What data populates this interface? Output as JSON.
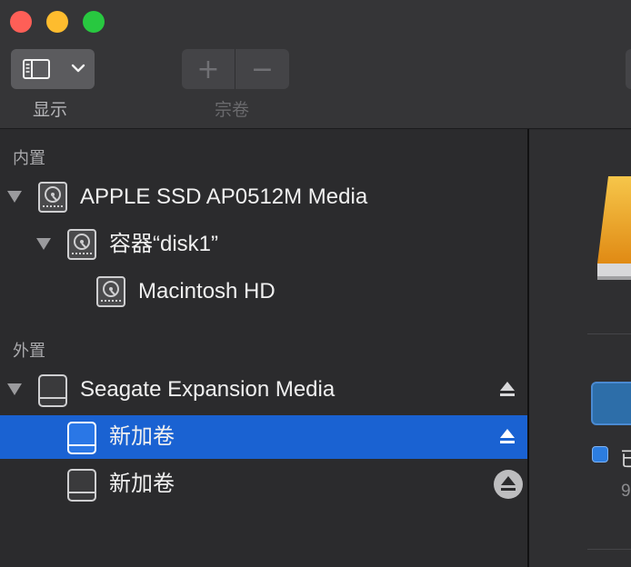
{
  "toolbar": {
    "display_label": "显示",
    "volume_label": "宗卷",
    "add_symbol": "+",
    "remove_symbol": "−"
  },
  "sidebar": {
    "internal_header": "内置",
    "external_header": "外置",
    "items": [
      {
        "label": "APPLE SSD AP0512M Media",
        "icon": "internal-disk-icon",
        "expanded": true
      },
      {
        "label": "容器“disk1”",
        "icon": "internal-disk-icon",
        "expanded": true
      },
      {
        "label": "Macintosh HD",
        "icon": "internal-disk-icon"
      },
      {
        "label": "Seagate Expansion Media",
        "icon": "external-disk-icon",
        "expanded": true,
        "eject": true
      },
      {
        "label": "新加卷",
        "icon": "external-disk-icon",
        "selected": true,
        "eject": true
      },
      {
        "label": "新加卷",
        "icon": "external-disk-icon",
        "eject": true
      }
    ]
  },
  "main": {
    "legend_text": "已",
    "legend_sub": "9"
  },
  "colors": {
    "selection": "#1a62d2",
    "window_bg": "#2a2a2c",
    "toolbar_bg": "#353537"
  }
}
